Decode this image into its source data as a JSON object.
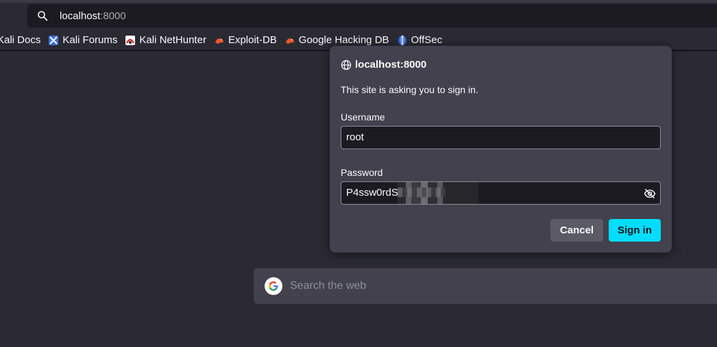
{
  "urlbar": {
    "host": "localhost",
    "port": ":8000",
    "icon": "search-icon"
  },
  "bookmarks": [
    {
      "label": "Kali Docs",
      "icon": "kali-docs-icon"
    },
    {
      "label": "Kali Forums",
      "icon": "kali-forums-icon"
    },
    {
      "label": "Kali NetHunter",
      "icon": "kali-nethunter-icon"
    },
    {
      "label": "Exploit-DB",
      "icon": "exploit-db-icon"
    },
    {
      "label": "Google Hacking DB",
      "icon": "google-hacking-db-icon"
    },
    {
      "label": "OffSec",
      "icon": "offsec-icon"
    }
  ],
  "dialog": {
    "host": "localhost:8000",
    "message": "This site is asking you to sign in.",
    "username_label": "Username",
    "username_value": "root",
    "password_label": "Password",
    "password_visible": "P4ssw0rdS",
    "cancel_label": "Cancel",
    "signin_label": "Sign in"
  },
  "newtab": {
    "search_placeholder": "Search the web"
  },
  "colors": {
    "accent": "#00ddff",
    "panel": "#42414d",
    "background": "#2b2a33"
  }
}
